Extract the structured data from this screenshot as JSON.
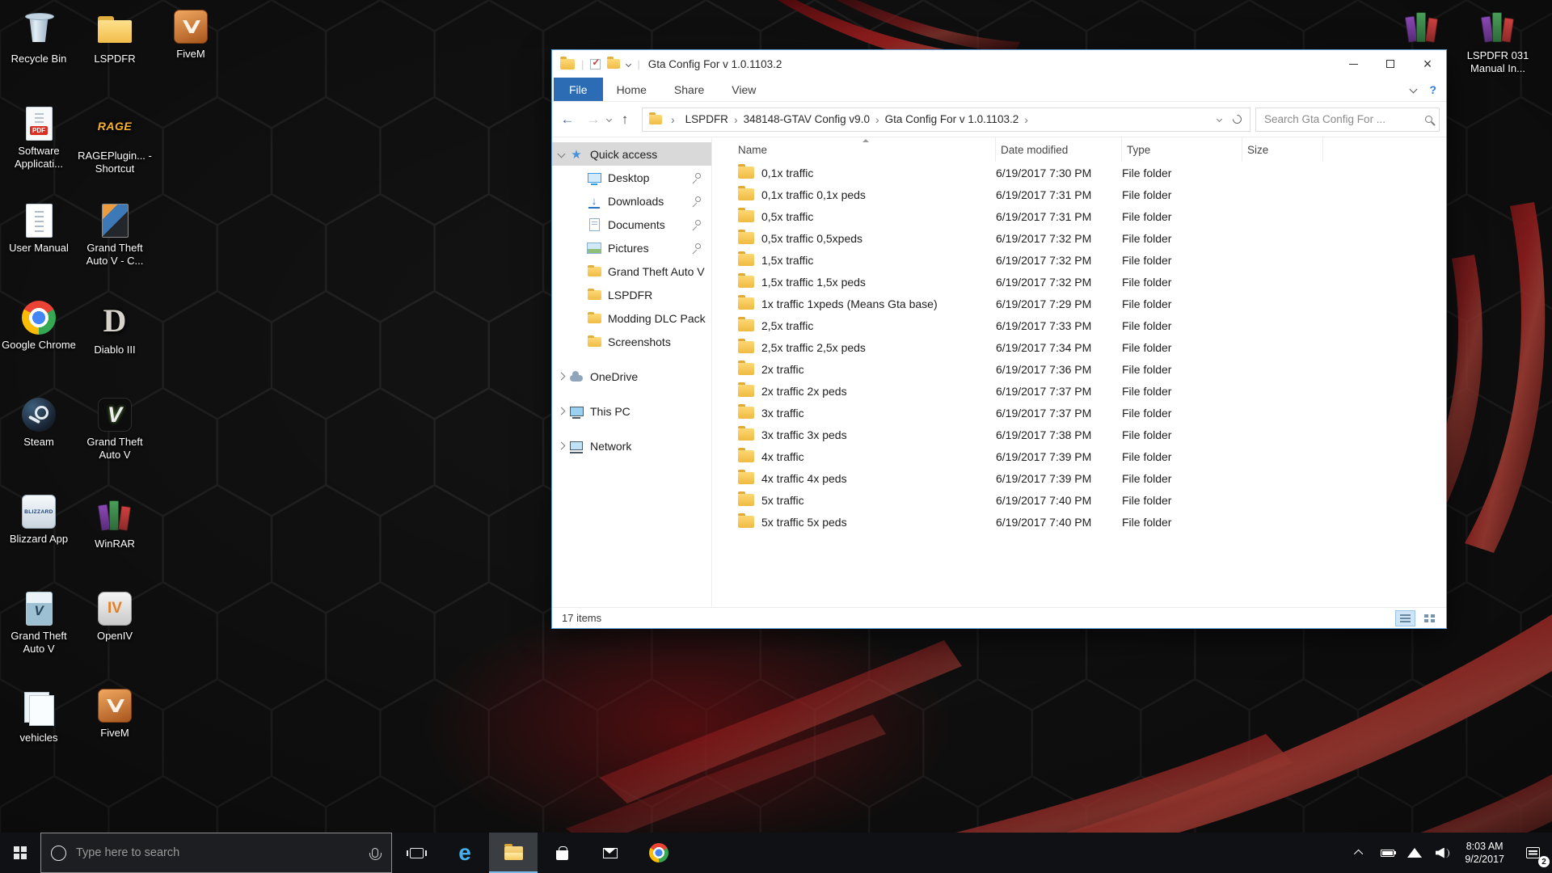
{
  "colors": {
    "accent_blue": "#2b6cb5",
    "folder_yellow": "#f1bd4a",
    "taskbar_black": "#101114",
    "wallpaper_red": "#c41e24",
    "window_border": "#63a2d8"
  },
  "desktop": {
    "icons": [
      {
        "name": "recycle-bin",
        "label": "Recycle Bin",
        "icon": "recycle",
        "col": 0,
        "row": 0
      },
      {
        "name": "software-application",
        "label": "Software Applicati...",
        "icon": "pdf",
        "col": 0,
        "row": 1
      },
      {
        "name": "user-manual",
        "label": "User Manual",
        "icon": "doc",
        "col": 0,
        "row": 2
      },
      {
        "name": "google-chrome",
        "label": "Google Chrome",
        "icon": "chrome",
        "col": 0,
        "row": 3
      },
      {
        "name": "steam",
        "label": "Steam",
        "icon": "steam",
        "col": 0,
        "row": 4
      },
      {
        "name": "blizzard-app",
        "label": "Blizzard App",
        "icon": "blizzard",
        "col": 0,
        "row": 5
      },
      {
        "name": "grand-theft-auto-v-box",
        "label": "Grand Theft Auto V",
        "icon": "box",
        "col": 0,
        "row": 6
      },
      {
        "name": "vehicles",
        "label": "vehicles",
        "icon": "stack",
        "col": 0,
        "row": 7
      },
      {
        "name": "lspdfr-folder",
        "label": "LSPDFR",
        "icon": "folder",
        "col": 1,
        "row": 0
      },
      {
        "name": "rageplugin-shortcut",
        "label": "RAGEPlugin... - Shortcut",
        "icon": "rage",
        "col": 1,
        "row": 1
      },
      {
        "name": "grand-theft-auto-v-c",
        "label": "Grand Theft Auto V - C...",
        "icon": "gtapage",
        "col": 1,
        "row": 2
      },
      {
        "name": "diablo-iii",
        "label": "Diablo III",
        "icon": "diablo",
        "col": 1,
        "row": 3
      },
      {
        "name": "grand-theft-auto-v",
        "label": "Grand Theft Auto V",
        "icon": "gtav",
        "col": 1,
        "row": 4
      },
      {
        "name": "winrar",
        "label": "WinRAR",
        "icon": "books",
        "col": 1,
        "row": 5
      },
      {
        "name": "openiv",
        "label": "OpenIV",
        "icon": "openiv",
        "col": 1,
        "row": 6
      },
      {
        "name": "fivem-2",
        "label": "FiveM",
        "icon": "fivem",
        "col": 1,
        "row": 7
      },
      {
        "name": "fivem",
        "label": "FiveM",
        "icon": "fivem",
        "col": 2,
        "row": 0
      }
    ],
    "topright": [
      {
        "name": "rar-archive",
        "label": "",
        "icon": "books"
      },
      {
        "name": "lspdfr-031-manual",
        "label": "LSPDFR 031 Manual In...",
        "icon": "books"
      }
    ]
  },
  "explorer": {
    "title": "Gta Config For v 1.0.1103.2",
    "menu_tabs": [
      "File",
      "Home",
      "Share",
      "View"
    ],
    "breadcrumb": [
      "LSPDFR",
      "348148-GTAV Config v9.0",
      "Gta Config For v 1.0.1103.2"
    ],
    "search_placeholder": "Search Gta Config For ...",
    "columns": [
      "Name",
      "Date modified",
      "Type",
      "Size"
    ],
    "sidebar": [
      {
        "label": "Quick access",
        "icon": "star",
        "level": 0,
        "chevron": "down",
        "selected": true
      },
      {
        "label": "Desktop",
        "icon": "desktop",
        "level": 1,
        "pin": true
      },
      {
        "label": "Downloads",
        "icon": "downloads",
        "level": 1,
        "pin": true
      },
      {
        "label": "Documents",
        "icon": "documents",
        "level": 1,
        "pin": true
      },
      {
        "label": "Pictures",
        "icon": "pictures",
        "level": 1,
        "pin": true
      },
      {
        "label": "Grand Theft Auto V",
        "icon": "folder",
        "level": 1
      },
      {
        "label": "LSPDFR",
        "icon": "folder",
        "level": 1
      },
      {
        "label": "Modding DLC Pack",
        "icon": "folder",
        "level": 1
      },
      {
        "label": "Screenshots",
        "icon": "folder",
        "level": 1
      },
      {
        "label": "OneDrive",
        "icon": "cloud",
        "level": 0,
        "chevron": "right",
        "gap": true
      },
      {
        "label": "This PC",
        "icon": "pc",
        "level": 0,
        "chevron": "right",
        "gap": true
      },
      {
        "label": "Network",
        "icon": "network",
        "level": 0,
        "chevron": "right",
        "gap": true
      }
    ],
    "files": [
      {
        "name": "0,1x traffic",
        "date": "6/19/2017 7:30 PM",
        "type": "File folder",
        "size": ""
      },
      {
        "name": "0,1x traffic 0,1x peds",
        "date": "6/19/2017 7:31 PM",
        "type": "File folder",
        "size": ""
      },
      {
        "name": "0,5x traffic",
        "date": "6/19/2017 7:31 PM",
        "type": "File folder",
        "size": ""
      },
      {
        "name": "0,5x traffic 0,5xpeds",
        "date": "6/19/2017 7:32 PM",
        "type": "File folder",
        "size": ""
      },
      {
        "name": "1,5x traffic",
        "date": "6/19/2017 7:32 PM",
        "type": "File folder",
        "size": ""
      },
      {
        "name": "1,5x traffic 1,5x peds",
        "date": "6/19/2017 7:32 PM",
        "type": "File folder",
        "size": ""
      },
      {
        "name": "1x traffic 1xpeds (Means Gta base)",
        "date": "6/19/2017 7:29 PM",
        "type": "File folder",
        "size": ""
      },
      {
        "name": "2,5x traffic",
        "date": "6/19/2017 7:33 PM",
        "type": "File folder",
        "size": ""
      },
      {
        "name": "2,5x traffic 2,5x peds",
        "date": "6/19/2017 7:34 PM",
        "type": "File folder",
        "size": ""
      },
      {
        "name": "2x traffic",
        "date": "6/19/2017 7:36 PM",
        "type": "File folder",
        "size": ""
      },
      {
        "name": "2x traffic 2x peds",
        "date": "6/19/2017 7:37 PM",
        "type": "File folder",
        "size": ""
      },
      {
        "name": "3x traffic",
        "date": "6/19/2017 7:37 PM",
        "type": "File folder",
        "size": ""
      },
      {
        "name": "3x traffic 3x peds",
        "date": "6/19/2017 7:38 PM",
        "type": "File folder",
        "size": ""
      },
      {
        "name": "4x traffic",
        "date": "6/19/2017 7:39 PM",
        "type": "File folder",
        "size": ""
      },
      {
        "name": "4x traffic 4x peds",
        "date": "6/19/2017 7:39 PM",
        "type": "File folder",
        "size": ""
      },
      {
        "name": "5x traffic",
        "date": "6/19/2017 7:40 PM",
        "type": "File folder",
        "size": ""
      },
      {
        "name": "5x traffic 5x peds",
        "date": "6/19/2017 7:40 PM",
        "type": "File folder",
        "size": ""
      }
    ],
    "status": "17 items"
  },
  "taskbar": {
    "search_placeholder": "Type here to search",
    "clock": {
      "time": "8:03 AM",
      "date": "9/2/2017"
    },
    "action_badge": "2"
  }
}
